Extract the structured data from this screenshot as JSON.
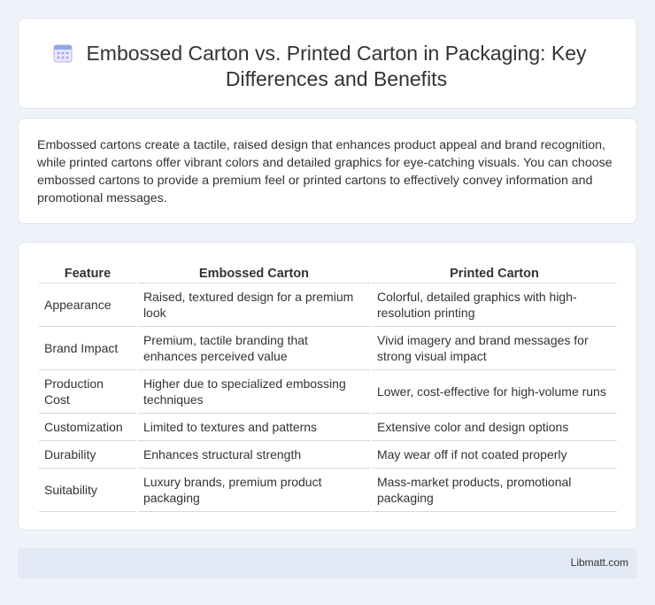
{
  "header": {
    "icon": "calendar-grid-icon",
    "title": "Embossed Carton vs. Printed Carton in Packaging: Key Differences and Benefits"
  },
  "intro": {
    "text": "Embossed cartons create a tactile, raised design that enhances product appeal and brand recognition, while printed cartons offer vibrant colors and detailed graphics for eye-catching visuals. You can choose embossed cartons to provide a premium feel or printed cartons to effectively convey information and promotional messages."
  },
  "table": {
    "headers": [
      "Feature",
      "Embossed Carton",
      "Printed Carton"
    ],
    "rows": [
      [
        "Appearance",
        "Raised, textured design for a premium look",
        "Colorful, detailed graphics with high-resolution printing"
      ],
      [
        "Brand Impact",
        "Premium, tactile branding that enhances perceived value",
        "Vivid imagery and brand messages for strong visual impact"
      ],
      [
        "Production Cost",
        "Higher due to specialized embossing techniques",
        "Lower, cost-effective for high-volume runs"
      ],
      [
        "Customization",
        "Limited to textures and patterns",
        "Extensive color and design options"
      ],
      [
        "Durability",
        "Enhances structural strength",
        "May wear off if not coated properly"
      ],
      [
        "Suitability",
        "Luxury brands, premium product packaging",
        "Mass-market products, promotional packaging"
      ]
    ]
  },
  "footer": {
    "site": "Libmatt.com"
  },
  "colors": {
    "background": "#eff3f9",
    "card": "#ffffff",
    "footer_bg": "#e3e9f5",
    "icon_accent": "#8a7fd6"
  }
}
